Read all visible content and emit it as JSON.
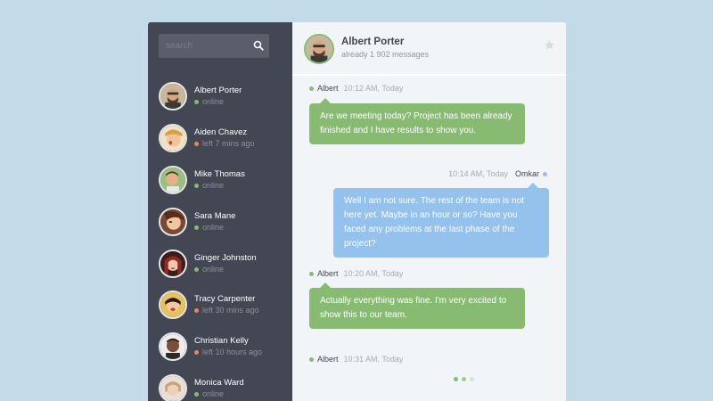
{
  "search": {
    "placeholder": "search",
    "icon": "search-icon"
  },
  "contacts": [
    {
      "name": "Albert Porter",
      "status": "online",
      "state": "online"
    },
    {
      "name": "Aiden Chavez",
      "status": "left 7 mins ago",
      "state": "away"
    },
    {
      "name": "Mike Thomas",
      "status": "online",
      "state": "online"
    },
    {
      "name": "Sara Mane",
      "status": "online",
      "state": "online"
    },
    {
      "name": "Ginger Johnston",
      "status": "online",
      "state": "online"
    },
    {
      "name": "Tracy Carpenter",
      "status": "left 30 mins ago",
      "state": "away"
    },
    {
      "name": "Christian Kelly",
      "status": "left 10 hours ago",
      "state": "away"
    },
    {
      "name": "Monica Ward",
      "status": "online",
      "state": "online"
    }
  ],
  "header": {
    "name": "Albert Porter",
    "count": "already 1 902 messages",
    "star_icon": "star-icon"
  },
  "messages": [
    {
      "author": "Albert",
      "time": "10:12 AM, Today",
      "side": "left",
      "text": "Are we meeting today? Project has been already finished and I have results to show you."
    },
    {
      "author": "Omkar",
      "time": "10:14 AM, Today",
      "side": "right",
      "text": "Well I am not sure. The rest of the team is not here yet. Maybe in an hour or so? Have you faced any problems at the last phase of the project?"
    },
    {
      "author": "Albert",
      "time": "10:20 AM, Today",
      "side": "left",
      "text": "Actually everything was fine. I'm very excited to show this to our team."
    },
    {
      "author": "Albert",
      "time": "10:31 AM, Today",
      "side": "left",
      "text": ""
    }
  ],
  "colors": {
    "green": "#86bb71",
    "blue": "#94c2ed",
    "away": "#e38968",
    "sidebar": "#434753"
  }
}
